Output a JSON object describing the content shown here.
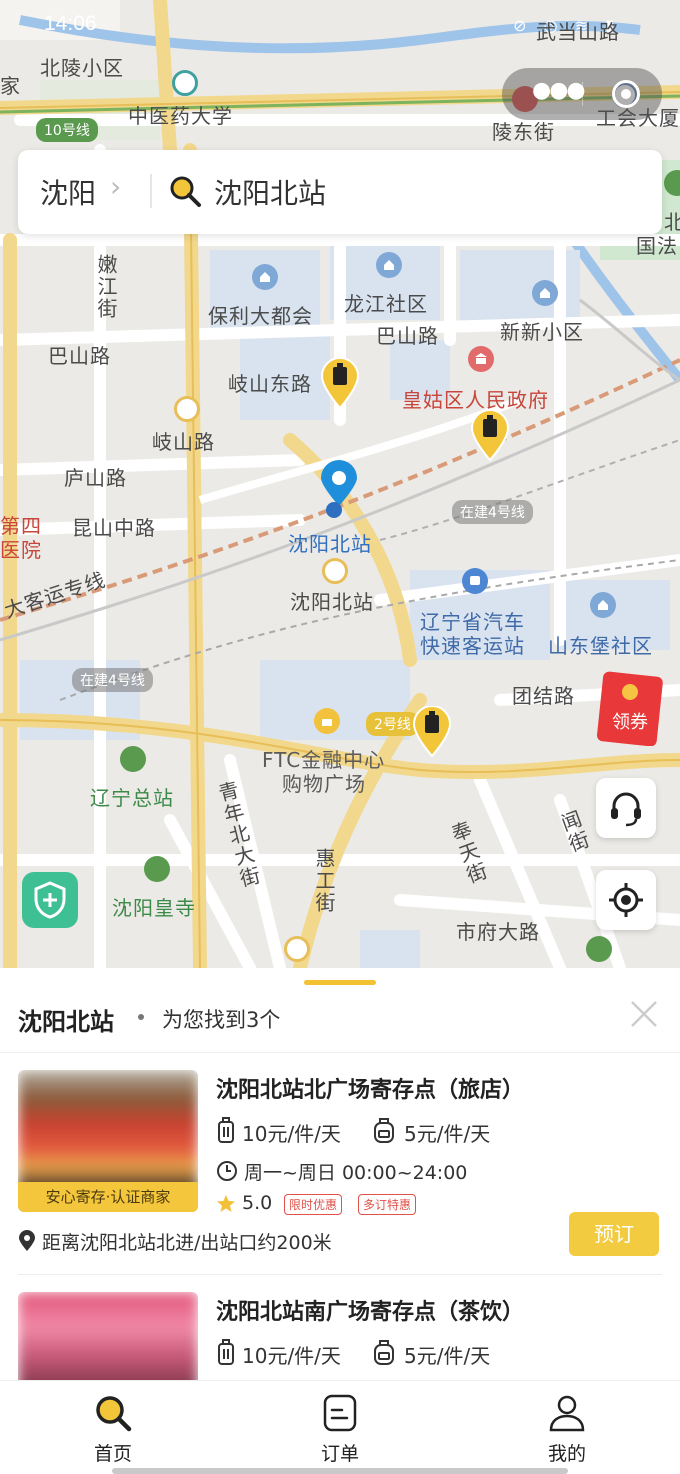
{
  "status_bar": {
    "time": "14:06",
    "icons": "⊘ ◎ ≋ ▮"
  },
  "map": {
    "road_labels": [
      "武当山路",
      "北陵小区",
      "中医药大学",
      "陵东街",
      "工会大厦",
      "国法",
      "嫩江街",
      "巴山路",
      "保利大都会",
      "龙江社区",
      "巴山路",
      "新新小区",
      "岐山东路",
      "皇姑区人民政府",
      "岐山路",
      "庐山路",
      "昆山中路",
      "第四",
      "医院",
      "大客运专线",
      "沈阳北站",
      "沈阳北站",
      "辽宁省汽车",
      "快速客运站",
      "山东堡社区",
      "团结路",
      "FTC金融中心",
      "购物广场",
      "辽宁总站",
      "青年北大街",
      "惠工街",
      "奉天街",
      "市府大路",
      "闻街",
      "沈阳皇寺",
      "家",
      "北",
      "院"
    ],
    "route_badges": {
      "line10": "10号线",
      "line4_a": "在建4号线",
      "line4_b": "在建4号线",
      "line2": "2号线"
    }
  },
  "search": {
    "city": "沈阳",
    "chevron": "›",
    "query": "沈阳北站"
  },
  "red_packet": {
    "label": "领券"
  },
  "sheet": {
    "title": "沈阳北站",
    "count_text": "为您找到3个",
    "cards": [
      {
        "name": "沈阳北站北广场寄存点（旅店）",
        "badge": "安心寄存·认证商家",
        "luggage_price": "10元/件/天",
        "bag_price": "5元/件/天",
        "hours": "周一~周日 00:00~24:00",
        "rating": "5.0",
        "tags": [
          "限时优惠",
          "多订特惠"
        ],
        "distance": "距离沈阳北站北进/出站口约200米",
        "book_label": "预订"
      },
      {
        "name": "沈阳北站南广场寄存点（茶饮）",
        "luggage_price": "10元/件/天",
        "bag_price": "5元/件/天"
      }
    ]
  },
  "tabs": [
    {
      "label": "首页",
      "icon": "search-icon"
    },
    {
      "label": "订单",
      "icon": "order-icon"
    },
    {
      "label": "我的",
      "icon": "profile-icon"
    }
  ],
  "colors": {
    "accent": "#f3cb40",
    "pin_blue": "#1f8fdc",
    "tag_red": "#e0524b",
    "shield_green": "#3fbf94"
  }
}
